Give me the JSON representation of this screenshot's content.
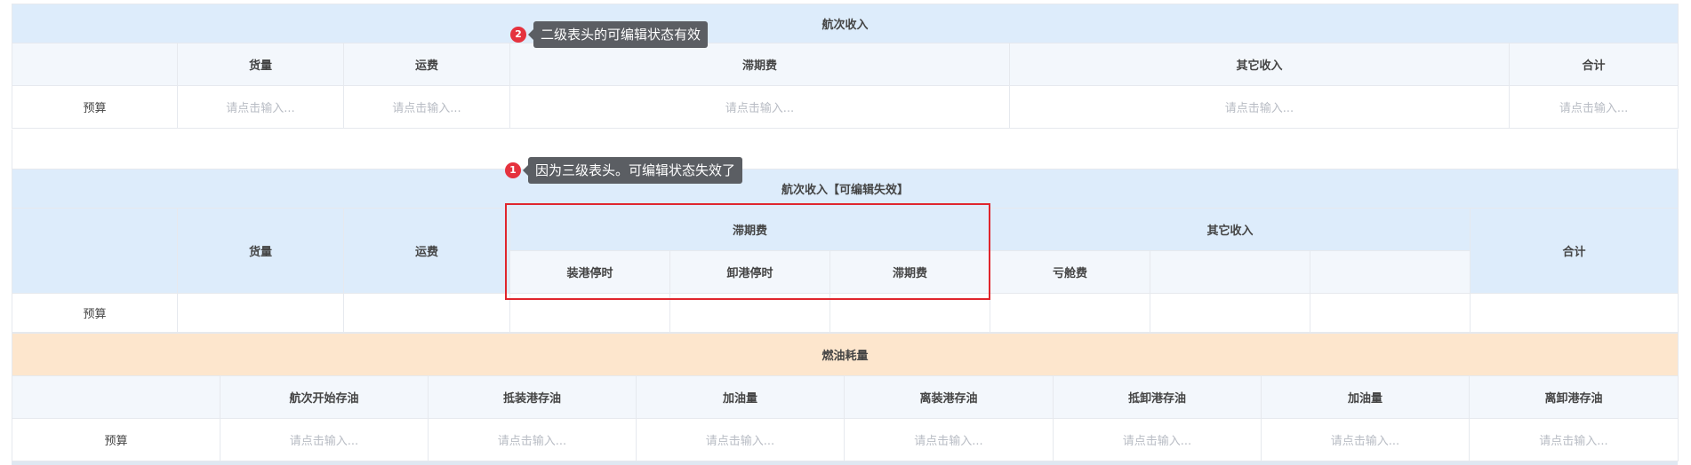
{
  "table1": {
    "title": "航次收入",
    "headers": [
      "货量",
      "运费",
      "滞期费",
      "其它收入",
      "合计"
    ],
    "row_label": "预算",
    "placeholder": "请点击输入..."
  },
  "table2": {
    "title": "航次收入【可编辑失效】",
    "col_goods": "货量",
    "col_freight": "运费",
    "group_demurrage": "滞期费",
    "group_other": "其它收入",
    "col_total": "合计",
    "sub_headers": [
      "装港停时",
      "卸港停时",
      "滞期费",
      "亏舱费",
      "",
      ""
    ],
    "row_label": "预算"
  },
  "table3": {
    "title": "燃油耗量",
    "headers": [
      "航次开始存油",
      "抵装港存油",
      "加油量",
      "离装港存油",
      "抵卸港存油",
      "加油量",
      "离卸港存油"
    ],
    "row_label": "预算",
    "placeholder": "请点击输入..."
  },
  "callouts": {
    "c1_num": "1",
    "c1_text": "因为三级表头。可编辑状态失效了",
    "c2_num": "2",
    "c2_text": "二级表头的可编辑状态有效"
  },
  "colors": {
    "header_blue": "#ddecfb",
    "header_light": "#f3f7fc",
    "header_orange": "#fde6cd",
    "highlight_red": "#e0262d",
    "badge_red": "#e5323e"
  }
}
